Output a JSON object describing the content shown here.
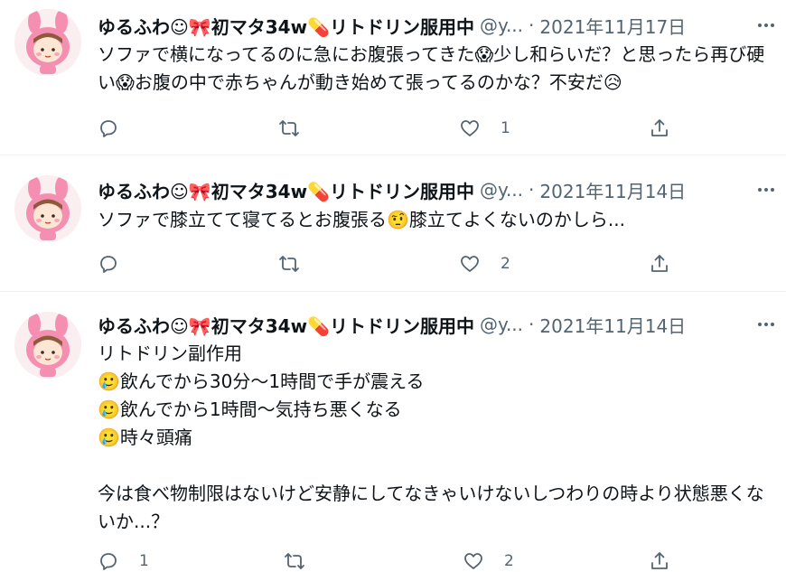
{
  "tweets": [
    {
      "name": "ゆるふわ☺🎀初マタ34w💊リトドリン服用中",
      "handle": "@y...",
      "dot": "·",
      "date": "2021年11月17日",
      "text": "ソファで横になってるのに急にお腹張ってきた😱少し和らいだ？と思ったら再び硬い😱お腹の中で赤ちゃんが動き始めて張ってるのかな？不安だ😥",
      "counts": {
        "reply": "",
        "retweet": "",
        "like": "1"
      }
    },
    {
      "name": "ゆるふわ☺🎀初マタ34w💊リトドリン服用中",
      "handle": "@y...",
      "dot": "·",
      "date": "2021年11月14日",
      "text": "ソファで膝立てて寝てるとお腹張る🤨膝立てよくないのかしら...",
      "counts": {
        "reply": "",
        "retweet": "",
        "like": "2"
      }
    },
    {
      "name": "ゆるふわ☺🎀初マタ34w💊リトドリン服用中",
      "handle": "@y...",
      "dot": "·",
      "date": "2021年11月14日",
      "text": "リトドリン副作用\n🥲飲んでから30分～1時間で手が震える\n🥲飲んでから1時間～気持ち悪くなる\n🥲時々頭痛\n\n今は食べ物制限はないけど安静にしてなきゃいけないしつわりの時より状態悪くないか...？",
      "counts": {
        "reply": "1",
        "retweet": "",
        "like": "2"
      }
    }
  ],
  "colors": {
    "text": "#0f1419",
    "secondary": "#536471",
    "divider": "#eff3f4",
    "avatar_bg": "#fbeef0",
    "avatar_pink": "#f48fb1"
  },
  "icons": [
    "reply-icon",
    "retweet-icon",
    "like-icon",
    "share-icon",
    "more-icon",
    "avatar-image"
  ]
}
